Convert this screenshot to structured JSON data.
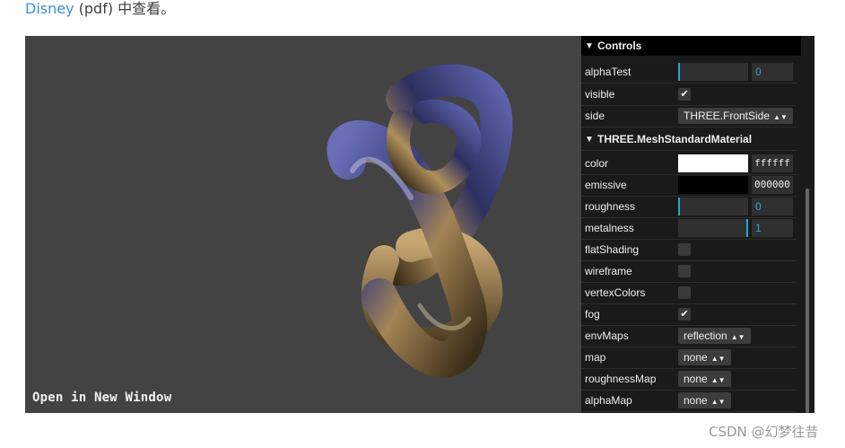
{
  "top_text": {
    "link": "Disney",
    "rest": " (pdf) 中查看。"
  },
  "viewer": {
    "open_window_label": "Open in New Window"
  },
  "controls": {
    "header": "Controls",
    "rows_top": [
      {
        "label": "alphaTest",
        "value": "0",
        "level": 0
      },
      {
        "label": "visible",
        "checked": true
      },
      {
        "label": "side",
        "select": "THREE.FrontSide"
      }
    ],
    "material_folder": "THREE.MeshStandardMaterial",
    "color": {
      "label": "color",
      "hex": "ffffff",
      "swatch": "#ffffff"
    },
    "emissive": {
      "label": "emissive",
      "hex": "000000",
      "swatch": "#000000"
    },
    "roughness": {
      "label": "roughness",
      "value": "0",
      "level": 0
    },
    "metalness": {
      "label": "metalness",
      "value": "1",
      "level": 1
    },
    "checks": [
      {
        "label": "flatShading",
        "checked": false
      },
      {
        "label": "wireframe",
        "checked": false
      },
      {
        "label": "vertexColors",
        "checked": false
      },
      {
        "label": "fog",
        "checked": true
      }
    ],
    "selects": [
      {
        "label": "envMaps",
        "value": "reflection"
      },
      {
        "label": "map",
        "value": "none"
      },
      {
        "label": "roughnessMap",
        "value": "none"
      },
      {
        "label": "alphaMap",
        "value": "none"
      }
    ]
  },
  "watermark": "CSDN @幻梦往昔",
  "colors": {
    "accent": "#2fa1d6",
    "link": "#3b8fd6",
    "viewer_bg": "#434343",
    "panel_bg": "#1a1a1a"
  }
}
